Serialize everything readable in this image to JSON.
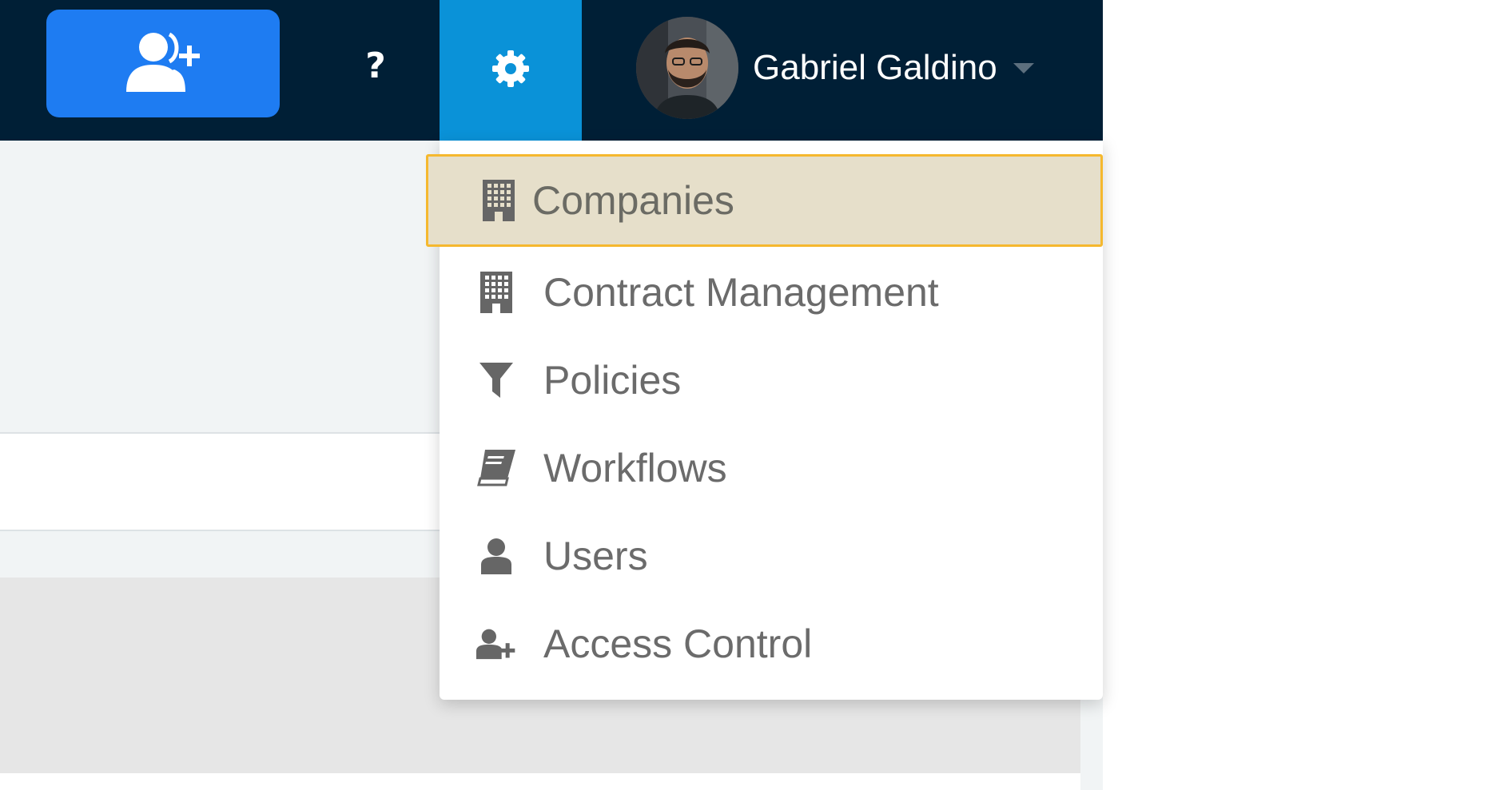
{
  "topbar": {
    "invite_icon": "user-plus-icon",
    "help_label": "?",
    "settings_icon": "gear-icon",
    "user": {
      "name": "Gabriel Galdino",
      "avatar_icon": "avatar-photo",
      "caret_icon": "caret-down-icon"
    }
  },
  "settings_menu": {
    "items": [
      {
        "label": "Companies",
        "icon": "building-icon",
        "highlighted": true
      },
      {
        "label": "Contract Management",
        "icon": "building-icon"
      },
      {
        "label": "Policies",
        "icon": "filter-icon"
      },
      {
        "label": "Workflows",
        "icon": "book-icon"
      },
      {
        "label": "Users",
        "icon": "user-icon"
      },
      {
        "label": "Access Control",
        "icon": "user-plus-icon"
      }
    ]
  },
  "colors": {
    "topbar_bg": "#001f36",
    "invite_button": "#1e7cf2",
    "settings_active": "#0a92d8",
    "highlight_bg": "#e6dfca",
    "highlight_border": "#f5b82e",
    "menu_text": "#6b6b6b"
  }
}
